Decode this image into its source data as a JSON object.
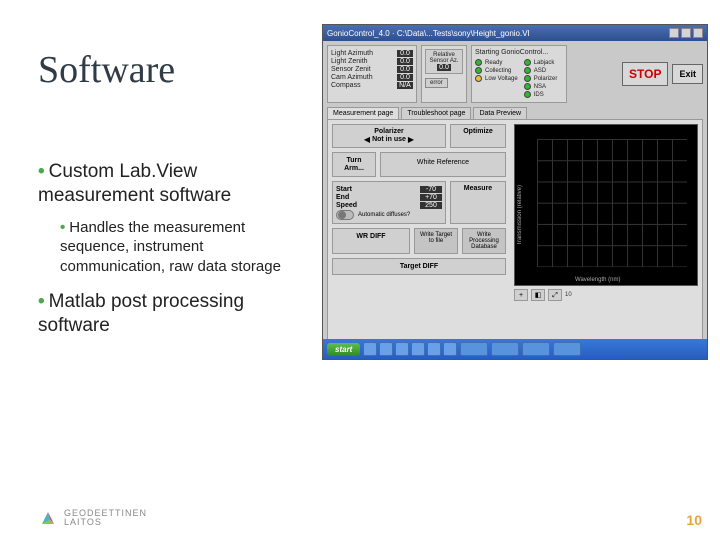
{
  "title": "Software",
  "bullets": {
    "b1a": "Custom Lab.View measurement software",
    "b2a": "Handles the measurement sequence, instrument communication, raw data storage",
    "b1b": "Matlab post processing software"
  },
  "page_number": "10",
  "logo_text_top": "GEODEETTINEN",
  "logo_text_bot": "LAITOS",
  "shot": {
    "titlebar": "GonioControl_4.0 · C:\\Data\\...Tests\\sony\\Height_gonio.VI",
    "win_buttons": [
      "min",
      "max",
      "close"
    ],
    "readouts": {
      "light_azimuth": {
        "label": "Light Azimuth",
        "value": "0.0"
      },
      "light_zenith": {
        "label": "Light Zenith",
        "value": "0.0"
      },
      "sensor_zenith": {
        "label": "Sensor Zenit",
        "value": "0.0"
      },
      "cam_azimuth": {
        "label": "Cam Azimuth",
        "value": "0.0"
      },
      "compass": {
        "label": "Compass",
        "value": "N/A"
      }
    },
    "relative": {
      "label": "Relative Sensor Az.",
      "value": "0.0"
    },
    "error_btn": "error",
    "status": {
      "heading": "Starting GonioControl...",
      "leds": [
        {
          "color": "g",
          "label": "Ready"
        },
        {
          "color": "g",
          "label": "Collecting"
        },
        {
          "color": "y",
          "label": "Low Voltage"
        }
      ],
      "leds2": [
        {
          "color": "g",
          "label": "Labjack"
        },
        {
          "color": "g",
          "label": "ASD"
        },
        {
          "color": "g",
          "label": "Polarizer"
        },
        {
          "color": "g",
          "label": "NSA"
        },
        {
          "color": "g",
          "label": "IDS"
        }
      ]
    },
    "stop": "STOP",
    "exit": "Exit",
    "tabs": [
      "Measurement page",
      "Troubleshoot page",
      "Data Preview"
    ],
    "polarizer": {
      "heading": "Polarizer",
      "mode": "Not in use"
    },
    "optimize": "Optimize",
    "turn_arm": "Turn Arm...",
    "white_ref": "White Reference",
    "scan": {
      "start": {
        "label": "Start",
        "value": "-70"
      },
      "end": {
        "label": "End",
        "value": "+70"
      },
      "speed": {
        "label": "Speed",
        "value": "250"
      },
      "auto_label": "Automatic diffuses?"
    },
    "measure": "Measure",
    "wr_diff": "WR DIFF",
    "target_diff": "Target DIFF",
    "write_target": "Write Target to file",
    "write_process": "Write Processing Database",
    "chart_ylabel": "Transmission (relative)",
    "chart_xlabel": "Wavelength (nm)",
    "chart_controls": {
      "icons": [
        "+",
        "◧",
        "⤢"
      ],
      "label": "10"
    },
    "taskbar": {
      "start": "start",
      "items": 6,
      "tasks": 4
    }
  }
}
